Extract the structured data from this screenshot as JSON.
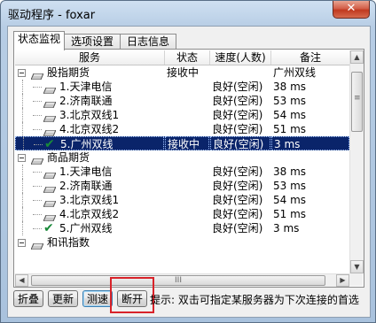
{
  "window": {
    "title": "驱动程序 - foxar",
    "close_label": "✕"
  },
  "tabs": [
    "状态监视",
    "选项设置",
    "日志信息"
  ],
  "columns": [
    "服务",
    "状态",
    "速度(人数)",
    "备注"
  ],
  "rows": [
    {
      "kind": "group",
      "name": "股指期货",
      "status": "接收中",
      "speed": "",
      "note": "广州双线"
    },
    {
      "kind": "item",
      "name": "1.天津电信",
      "status": "",
      "speed": "良好(空闲)",
      "note": "38 ms"
    },
    {
      "kind": "item",
      "name": "2.济南联通",
      "status": "",
      "speed": "良好(空闲)",
      "note": "53 ms"
    },
    {
      "kind": "item",
      "name": "3.北京双线1",
      "status": "",
      "speed": "良好(空闲)",
      "note": "54 ms"
    },
    {
      "kind": "item",
      "name": "4.北京双线2",
      "status": "",
      "speed": "良好(空闲)",
      "note": "51 ms"
    },
    {
      "kind": "active",
      "name": "5.广州双线",
      "status": "接收中",
      "speed": "良好(空闲)",
      "note": "3 ms",
      "selected": true
    },
    {
      "kind": "group",
      "name": "商品期货",
      "status": "",
      "speed": "",
      "note": ""
    },
    {
      "kind": "item",
      "name": "1.天津电信",
      "status": "",
      "speed": "良好(空闲)",
      "note": "38 ms"
    },
    {
      "kind": "item",
      "name": "2.济南联通",
      "status": "",
      "speed": "良好(空闲)",
      "note": "53 ms"
    },
    {
      "kind": "item",
      "name": "3.北京双线1",
      "status": "",
      "speed": "良好(空闲)",
      "note": "54 ms"
    },
    {
      "kind": "item",
      "name": "4.北京双线2",
      "status": "",
      "speed": "良好(空闲)",
      "note": "51 ms"
    },
    {
      "kind": "active",
      "name": "5.广州双线",
      "status": "",
      "speed": "良好(空闲)",
      "note": "3 ms"
    },
    {
      "kind": "group",
      "name": "和讯指数",
      "status": "",
      "speed": "",
      "note": ""
    }
  ],
  "scrollbar": {
    "up": "▲",
    "down": "▼",
    "left": "◀",
    "right": "▶",
    "grip": "III"
  },
  "buttons": [
    "折叠",
    "更新",
    "测速",
    "断开"
  ],
  "hint": "提示: 双击可指定某服务器为下次连接的首选",
  "colors": {
    "selection": "#0a246a",
    "check": "#1a8a3a",
    "highlight_box": "#d8232a"
  }
}
